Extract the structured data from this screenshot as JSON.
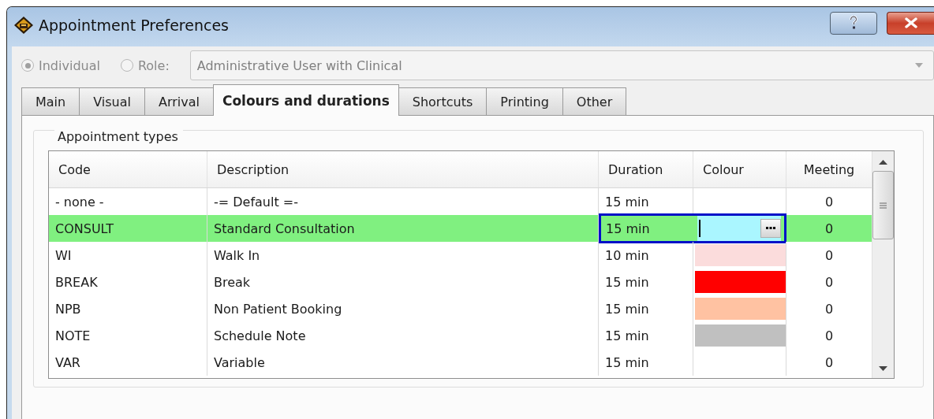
{
  "window": {
    "title": "Appointment Preferences"
  },
  "scope": {
    "options": [
      {
        "label": "Individual",
        "selected": true
      },
      {
        "label": "Role:",
        "selected": false
      }
    ],
    "role": "Administrative User with Clinical",
    "disabled": true
  },
  "tabs": [
    {
      "label": "Main",
      "selected": false
    },
    {
      "label": "Visual",
      "selected": false
    },
    {
      "label": "Arrival",
      "selected": false
    },
    {
      "label": "Colours and durations",
      "selected": true
    },
    {
      "label": "Shortcuts",
      "selected": false
    },
    {
      "label": "Printing",
      "selected": false
    },
    {
      "label": "Other",
      "selected": false
    }
  ],
  "group": {
    "title": "Appointment types"
  },
  "table": {
    "columns": [
      "Code",
      "Description",
      "Duration",
      "Colour",
      "Meeting"
    ],
    "rows": [
      {
        "code": "- none -",
        "description": "-= Default =-",
        "duration": "15 min",
        "meeting": "0",
        "selected": false
      },
      {
        "code": "CONSULT",
        "description": "Standard Consultation",
        "duration": "15 min",
        "color": "#aaf6ff",
        "meeting": "0",
        "selected": true
      },
      {
        "code": "WI",
        "description": "Walk In",
        "duration": "10 min",
        "color": "#fbdcdc",
        "meeting": "0",
        "selected": false
      },
      {
        "code": "BREAK",
        "description": "Break",
        "duration": "15 min",
        "color": "#ff0000",
        "meeting": "0",
        "selected": false
      },
      {
        "code": "NPB",
        "description": "Non Patient Booking",
        "duration": "15 min",
        "color": "#ffc2a2",
        "meeting": "0",
        "selected": false
      },
      {
        "code": "NOTE",
        "description": "Schedule Note",
        "duration": "15 min",
        "color": "#c0c0c0",
        "meeting": "0",
        "selected": false
      },
      {
        "code": "VAR",
        "description": "Variable",
        "duration": "15 min",
        "meeting": "0",
        "selected": false
      }
    ]
  }
}
